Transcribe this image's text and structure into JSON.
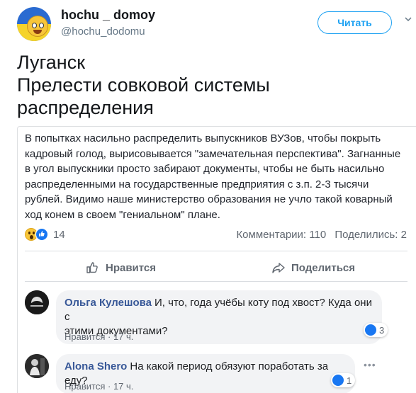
{
  "tweet": {
    "display_name": "hochu _ domoy",
    "handle": "@hochu_dodomu",
    "follow_label": "Читать",
    "text_lines": [
      "Луганск",
      "Прелести совковой  системы",
      "распределения"
    ]
  },
  "post": {
    "text": "В попытках насильно распределить выпускников ВУЗов, чтобы покрыть кадровый голод, вырисовывается \"замечательная перспектива\". Загнанные в угол выпускники просто забирают документы, чтобы не быть насильно распределенными на государственные предприятия с з.п. 2-3 тысячи рублей. Видимо наше министерство образования не учло такой коварный ход конем в своем \"гениальном\" плане.",
    "reaction_count": "14",
    "comments_stat": "Комментарии: 110",
    "shares_stat": "Поделились: 2",
    "like_action": "Нравится",
    "share_action": "Поделиться"
  },
  "comments": [
    {
      "author": "Ольга Кулешова",
      "text_line1": "И, что, года учёбы коту под хвост? Куда они с",
      "text_line2": "этими документами?",
      "like_link": "Нравится",
      "time": "17 ч.",
      "likes": "3"
    },
    {
      "author": "Alona Shero",
      "text_line1": "На какой период обязуют поработать за еду?",
      "like_link": "Нравится",
      "time": "17 ч.",
      "likes": "1"
    }
  ],
  "colors": {
    "twitter_blue": "#1da1f2",
    "facebook_blue": "#1877f2",
    "author_link": "#385898"
  }
}
